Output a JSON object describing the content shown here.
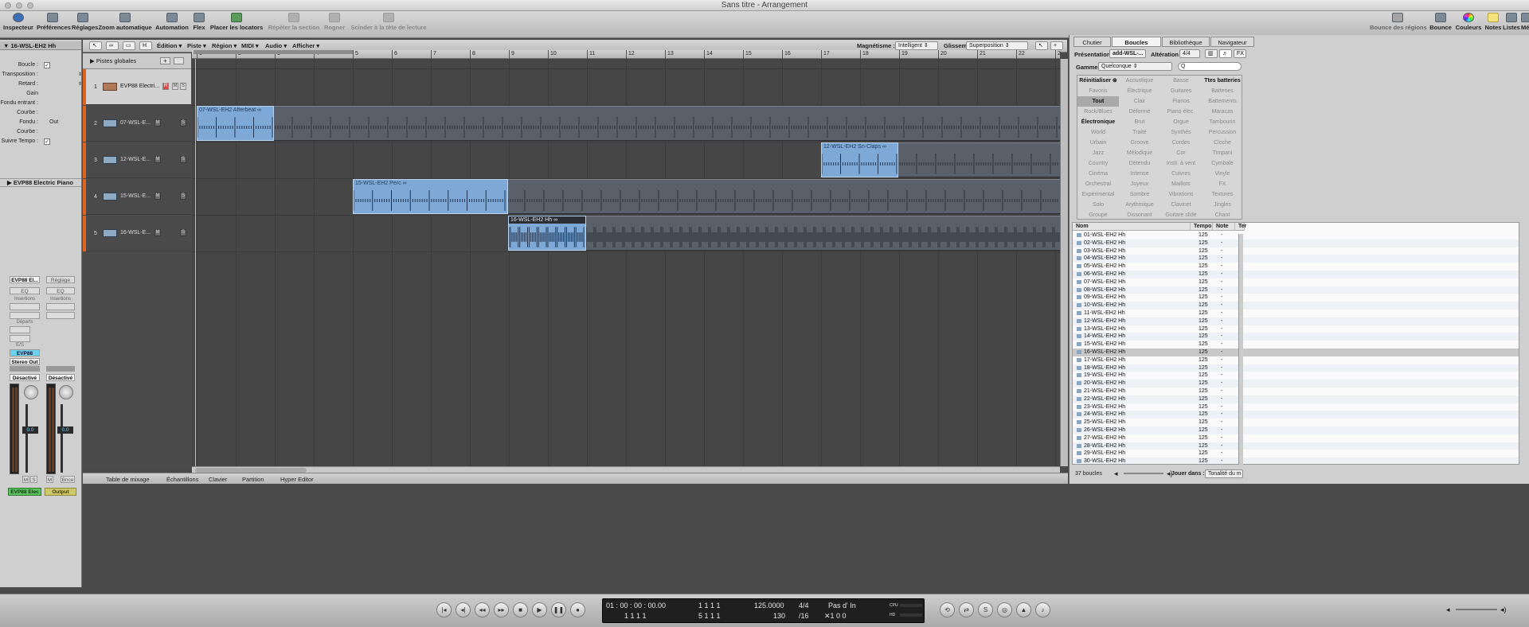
{
  "window": {
    "title": "Sans titre - Arrangement"
  },
  "toolbar": {
    "left": [
      "Inspecteur",
      "Préférences",
      "Réglages",
      "Zoom automatique",
      "Automation",
      "Flex",
      "Placer les locators"
    ],
    "left_disabled": [
      "Répéter la section",
      "Rogner",
      "Scinder à la tête de lecture"
    ],
    "right": [
      "Bounce des régions",
      "Bounce",
      "Couleurs",
      "Notes",
      "Listes",
      "Média"
    ]
  },
  "inspector": {
    "region_name": "16-WSL-EH2 Hh",
    "params": [
      {
        "label": "Boucle :",
        "value": ""
      },
      {
        "label": "Transposition :",
        "value": ""
      },
      {
        "label": "Retard :",
        "value": ""
      },
      {
        "label": "Gain",
        "value": ""
      },
      {
        "label": "Fondu entrant :",
        "value": ""
      },
      {
        "label": "Courbe :",
        "value": ""
      },
      {
        "label": "Fondu :",
        "value": "Out"
      },
      {
        "label": "Courbe :",
        "value": ""
      },
      {
        "label": "Suivre Tempo :",
        "value": ""
      }
    ],
    "track_header": "EVP88 Electric Piano",
    "strip1": {
      "setting": "EVP88 El...",
      "eq": "EQ",
      "inserts": "Insertions",
      "sends": "Départs",
      "io": "E/S",
      "instrument": "EVP88",
      "output": "Stereo Out",
      "automation": "Désactivé",
      "value": "0.0",
      "name": "EVP88 Elec",
      "m": "M",
      "s": "S"
    },
    "strip2": {
      "setting": "Réglage",
      "eq": "EQ",
      "inserts": "Insertions",
      "automation": "Désactivé",
      "value": "0.0",
      "name": "Output",
      "m": "M",
      "bounce": "Bnce"
    }
  },
  "arrange_menu": {
    "items": [
      "Édition",
      "Piste",
      "Région",
      "MIDI",
      "Audio",
      "Afficher"
    ],
    "snap_label": "Magnétisme :",
    "snap_value": "Intelligent",
    "drag_label": "Glissement :",
    "drag_value": "Superposition"
  },
  "global_tracks": "Pistes globales",
  "tracks": [
    {
      "num": "1",
      "name": "EVP88 Electri...",
      "r": "R",
      "m": "M",
      "s": "S"
    },
    {
      "num": "2",
      "name": "07-WSL-E...",
      "m": "M",
      "s": "S"
    },
    {
      "num": "3",
      "name": "12-WSL-E...",
      "m": "M",
      "s": "S"
    },
    {
      "num": "4",
      "name": "15-WSL-E...",
      "m": "M",
      "s": "S"
    },
    {
      "num": "5",
      "name": "16-WSL-E...",
      "m": "M",
      "s": "S"
    }
  ],
  "ruler": [
    "1",
    "2",
    "3",
    "4",
    "5",
    "6",
    "7",
    "8",
    "9",
    "10",
    "11",
    "12",
    "13",
    "14",
    "15",
    "16",
    "17",
    "18",
    "19",
    "20",
    "21",
    "22",
    "2"
  ],
  "regions": [
    {
      "name": "07-WSL-EH2 Afterbeat ∞"
    },
    {
      "name": "12-WSL-EH2 Sn-Claps ∞"
    },
    {
      "name": "15-WSL-EH2 Perc ∞"
    },
    {
      "name": "16-WSL-EH2 Hh ∞"
    }
  ],
  "bottom_tabs": [
    "Table de mixage",
    "Échantillons",
    "Clavier",
    "Partition",
    "Hyper Editor"
  ],
  "browser": {
    "tabs": [
      "Chutier",
      "Boucles",
      "Bibliothèque",
      "Navigateur"
    ],
    "presentation_label": "Présentation :",
    "presentation_value": "add-WSL-...",
    "alteration_label": "Altération :",
    "alteration_value": "4/4",
    "scale_label": "Gamme :",
    "scale_value": "Quelconque",
    "search_value": "Q",
    "keywords": [
      [
        "Réinitialiser ⊗",
        "Acoustique",
        "Basse",
        "Ttes batteries"
      ],
      [
        "Favoris",
        "Électrique",
        "Guitares",
        "Batteries"
      ],
      [
        "Tout",
        "Clair",
        "Pianos",
        "Battements"
      ],
      [
        "Rock/Blues",
        "Déformé",
        "Piano élec.",
        "Maracas"
      ],
      [
        "Électronique",
        "Brut",
        "Orgue",
        "Tambourin"
      ],
      [
        "World",
        "Traité",
        "Synthés",
        "Percussion"
      ],
      [
        "Urbain",
        "Groove",
        "Cordes",
        "Cloche"
      ],
      [
        "Jazz",
        "Mélodique",
        "Cor",
        "Timpani"
      ],
      [
        "Country",
        "Détendu",
        "Instr. à vent",
        "Cymbale"
      ],
      [
        "Cinéma",
        "Intense",
        "Cuivres",
        "Vinyle"
      ],
      [
        "Orchestral",
        "Joyeux",
        "Maillots",
        "FX"
      ],
      [
        "Expérimental",
        "Sombre",
        "Vibrations",
        "Textures"
      ],
      [
        "Solo",
        "Arythmique",
        "Clavinet",
        "Jingles"
      ],
      [
        "Groupe",
        "Dissonant",
        "Guitare slide",
        "Chant"
      ]
    ],
    "columns": [
      "Nom",
      "Tempo",
      "Note",
      "Ter"
    ],
    "results": [
      "01-WSL-EH2 Hh",
      "02-WSL-EH2 Hh",
      "03-WSL-EH2 Hh",
      "04-WSL-EH2 Hh",
      "05-WSL-EH2 Hh",
      "06-WSL-EH2 Hh",
      "07-WSL-EH2 Hh",
      "08-WSL-EH2 Hh",
      "09-WSL-EH2 Hh",
      "10-WSL-EH2 Hh",
      "11-WSL-EH2 Hh",
      "12-WSL-EH2 Hh",
      "13-WSL-EH2 Hh",
      "14-WSL-EH2 Hh",
      "15-WSL-EH2 Hh",
      "16-WSL-EH2 Hh",
      "17-WSL-EH2 Hh",
      "18-WSL-EH2 Hh",
      "19-WSL-EH2 Hh",
      "20-WSL-EH2 Hh",
      "21-WSL-EH2 Hh",
      "22-WSL-EH2 Hh",
      "23-WSL-EH2 Hh",
      "24-WSL-EH2 Hh",
      "25-WSL-EH2 Hh",
      "26-WSL-EH2 Hh",
      "27-WSL-EH2 Hh",
      "28-WSL-EH2 Hh",
      "29-WSL-EH2 Hh",
      "30-WSL-EH2 Hh"
    ],
    "tempo": "125",
    "note": "-",
    "count": "37 boucles",
    "play_label": "Jouer dans :",
    "play_value": "Tonalité du m"
  },
  "transport": {
    "smpte": "01 : 00 : 00 : 00.00",
    "smpte_sub": "1   1   1   1",
    "bars": "1   1   1   1",
    "bars_sub": "5   1   1   1",
    "tempo": "125.0000",
    "tempo_sub": "130",
    "sig": "4/4",
    "sig_sub": "/16",
    "in_label": "Pas d' In",
    "in_sub": "✕1   0   0",
    "cpu": "CPU",
    "hd": "HD"
  }
}
